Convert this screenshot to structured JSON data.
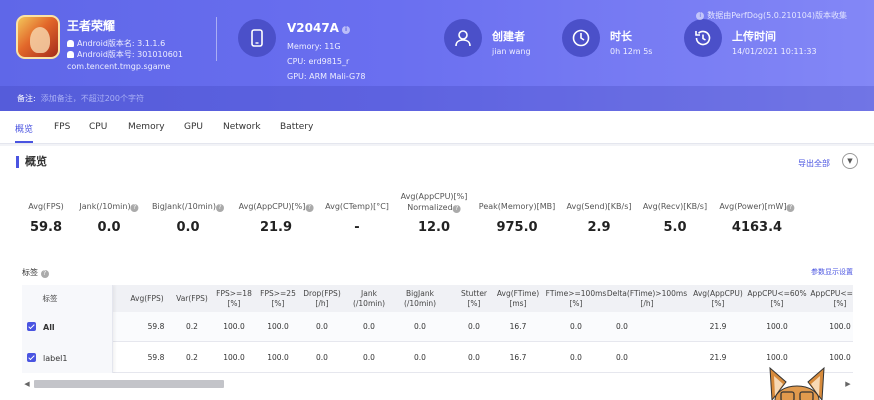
{
  "app": {
    "name": "王者荣耀",
    "android_version": "Android版本名: 3.1.1.6",
    "version_code": "Android版本号: 301010601",
    "package": "com.tencent.tmgp.sgame"
  },
  "device": {
    "name": "V2047A",
    "memory": "Memory: 11G",
    "cpu": "CPU: erd9815_r",
    "gpu": "GPU: ARM Mali-G78"
  },
  "creator": {
    "label": "创建者",
    "value": "jian wang"
  },
  "duration": {
    "label": "时长",
    "value": "0h 12m 5s"
  },
  "upload": {
    "label": "上传时间",
    "value": "14/01/2021 10:11:33"
  },
  "version_note": "数据由PerfDog(5.0.210104)版本收集",
  "notes": {
    "label": "备注:",
    "placeholder": "添加备注，不超过200个字符"
  },
  "tabs": [
    "概览",
    "FPS",
    "CPU",
    "Memory",
    "GPU",
    "Network",
    "Battery"
  ],
  "overview": {
    "title": "概览",
    "export": "导出全部",
    "metrics": [
      {
        "label": "Avg(FPS)",
        "value": "59.8"
      },
      {
        "label": "Jank(/10min)",
        "value": "0.0"
      },
      {
        "label": "BigJank(/10min)",
        "value": "0.0"
      },
      {
        "label": "Avg(AppCPU)[%]",
        "value": "21.9"
      },
      {
        "label": "Avg(CTemp)[°C]",
        "value": "-"
      },
      {
        "label": "Avg(AppCPU)[%]",
        "label2": "Normalized",
        "value": "12.0"
      },
      {
        "label": "Peak(Memory)[MB]",
        "value": "975.0"
      },
      {
        "label": "Avg(Send)[KB/s]",
        "value": "2.9"
      },
      {
        "label": "Avg(Recv)[KB/s]",
        "value": "5.0"
      },
      {
        "label": "Avg(Power)[mW]",
        "value": "4163.4"
      }
    ],
    "tags_label": "标签",
    "param_settings": "参数显示设置"
  },
  "table": {
    "columns": [
      {
        "l1": "标签",
        "l2": ""
      },
      {
        "l1": "Avg(FPS)",
        "l2": ""
      },
      {
        "l1": "Var(FPS)",
        "l2": ""
      },
      {
        "l1": "FPS>=18",
        "l2": "[%]"
      },
      {
        "l1": "FPS>=25",
        "l2": "[%]"
      },
      {
        "l1": "Drop(FPS)",
        "l2": "[/h]"
      },
      {
        "l1": "Jank",
        "l2": "(/10min)"
      },
      {
        "l1": "BigJank",
        "l2": "(/10min)"
      },
      {
        "l1": "Stutter",
        "l2": "[%]"
      },
      {
        "l1": "Avg(FTime)",
        "l2": "[ms]"
      },
      {
        "l1": "FTime>=100ms",
        "l2": "[%]"
      },
      {
        "l1": "Delta(FTime)>100ms",
        "l2": "[/h]"
      },
      {
        "l1": "Avg(AppCPU)",
        "l2": "[%]"
      },
      {
        "l1": "AppCPU<=60%",
        "l2": "[%]"
      },
      {
        "l1": "AppCPU<=80%",
        "l2": "[%]"
      }
    ],
    "rows": [
      {
        "label": "All",
        "cells": [
          "59.8",
          "0.2",
          "100.0",
          "100.0",
          "0.0",
          "0.0",
          "0.0",
          "0.0",
          "16.7",
          "0.0",
          "0.0",
          "21.9",
          "100.0",
          "100.0"
        ]
      },
      {
        "label": "label1",
        "cells": [
          "59.8",
          "0.2",
          "100.0",
          "100.0",
          "0.0",
          "0.0",
          "0.0",
          "0.0",
          "16.7",
          "0.0",
          "0.0",
          "21.9",
          "100.0",
          "100.0"
        ]
      }
    ]
  },
  "icons": {
    "device": "phone-icon",
    "creator": "user-icon",
    "duration": "clock-icon",
    "upload": "history-icon"
  },
  "colors": {
    "header": "#6a6ff0",
    "accent": "#4a54e1"
  }
}
